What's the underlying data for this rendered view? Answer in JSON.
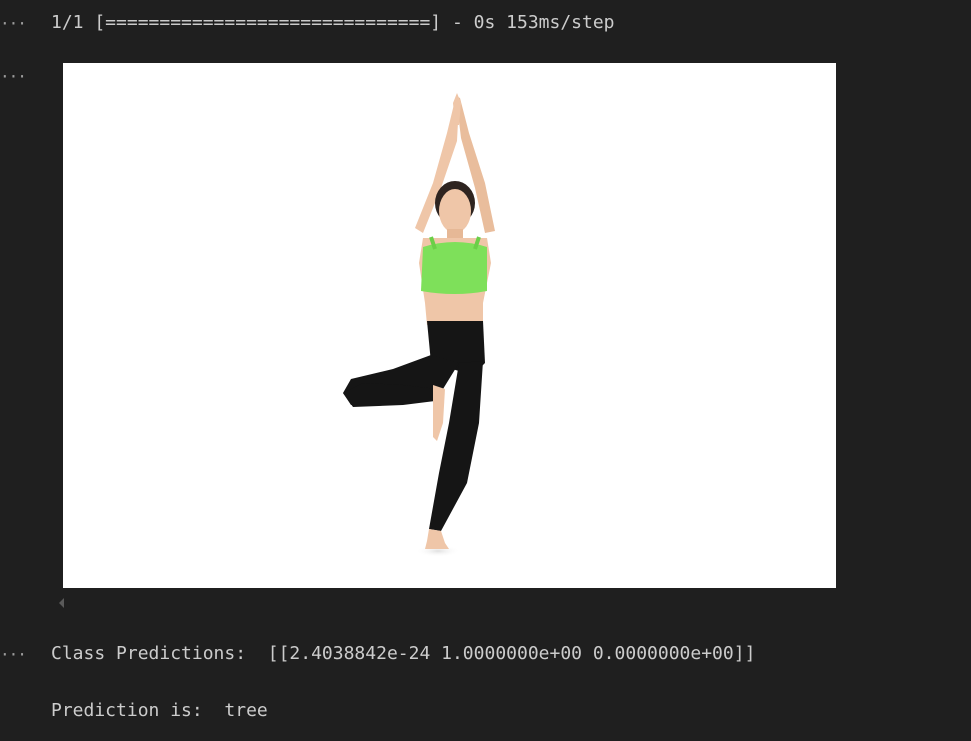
{
  "cells": [
    {
      "gutter_icon": "more-horizontal-icon",
      "output": "1/1 [==============================] - 0s 153ms/step"
    },
    {
      "gutter_icon": "more-horizontal-icon",
      "image": "photo of woman in green sports bra and black leggings doing tree yoga pose on white background"
    },
    {
      "gutter_icon": "more-horizontal-icon",
      "output_lines": [
        "Class Predictions:  [[2.4038842e-24 1.0000000e+00 0.0000000e+00]]",
        "Prediction is:  tree"
      ]
    }
  ],
  "scroll_indicator_icon": "caret-left-icon",
  "colors": {
    "background": "#1f1f1f",
    "text": "#cccccc",
    "top_color": "#7ee05a",
    "leggings_color": "#151515",
    "skin_color": "#efc6a8"
  }
}
